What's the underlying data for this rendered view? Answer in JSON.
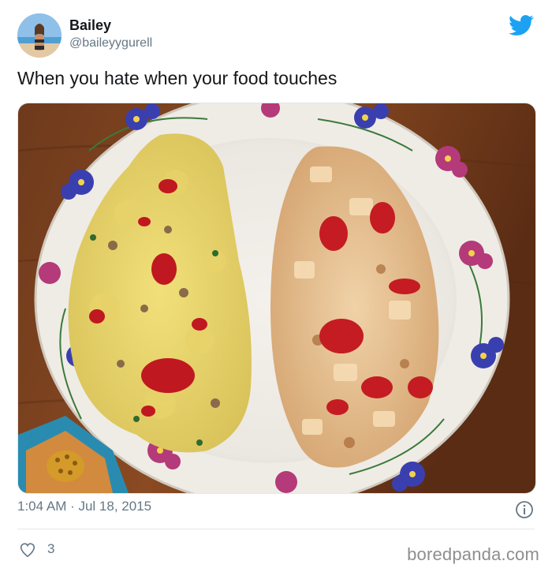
{
  "tweet": {
    "author_name": "Bailey",
    "author_handle": "@baileyygurell",
    "text": "When you hate when your food touches",
    "timestamp": "1:04 AM · Jul 18, 2015",
    "like_count": "3"
  },
  "watermark": "boredpanda.com",
  "colors": {
    "twitter_blue": "#1da1f2",
    "secondary_text": "#657786",
    "divider": "#e1e8ed"
  },
  "icons": {
    "brand": "twitter-bird-icon",
    "info": "info-icon",
    "like": "heart-icon"
  }
}
